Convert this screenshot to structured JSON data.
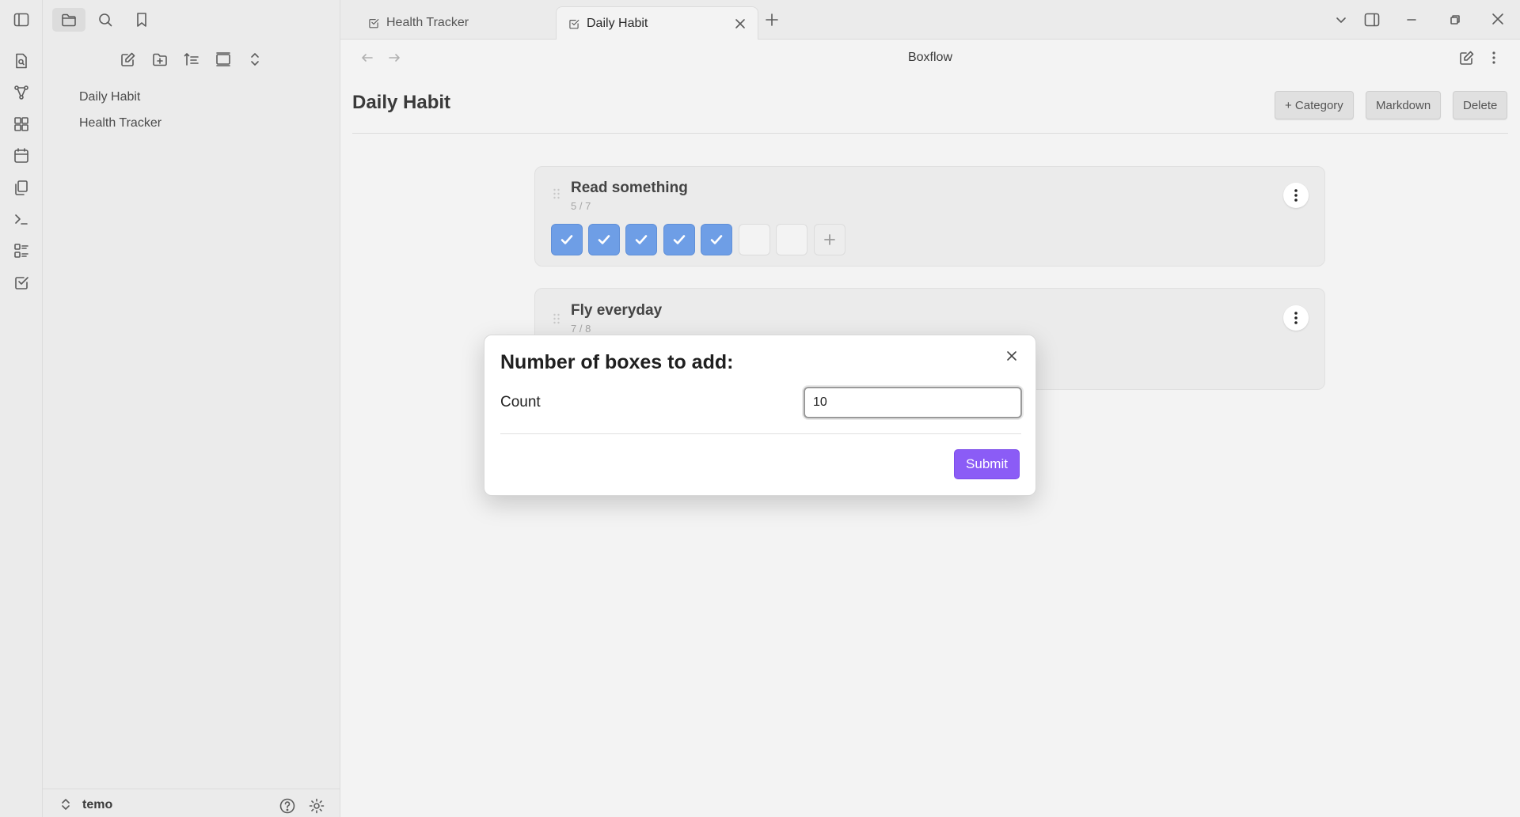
{
  "tabs": [
    {
      "label": "Health Tracker",
      "active": false
    },
    {
      "label": "Daily Habit",
      "active": true
    }
  ],
  "sidebar": {
    "files": [
      "Daily Habit",
      "Health Tracker"
    ],
    "vault_name": "temo"
  },
  "view": {
    "header_title": "Boxflow",
    "page_title": "Daily Habit",
    "buttons": {
      "category": "+ Category",
      "markdown": "Markdown",
      "delete": "Delete"
    }
  },
  "habits": [
    {
      "name": "Read something",
      "count": "5 / 7",
      "checked": 5,
      "total": 7
    },
    {
      "name": "Fly everyday",
      "count": "7 / 8",
      "checked": 7,
      "total": 8
    }
  ],
  "modal": {
    "title": "Number of boxes to add:",
    "field_label": "Count",
    "field_value": "10",
    "submit_label": "Submit"
  },
  "colors": {
    "accent": "#8b5cf6",
    "checked_box": "#6e9ee6"
  }
}
